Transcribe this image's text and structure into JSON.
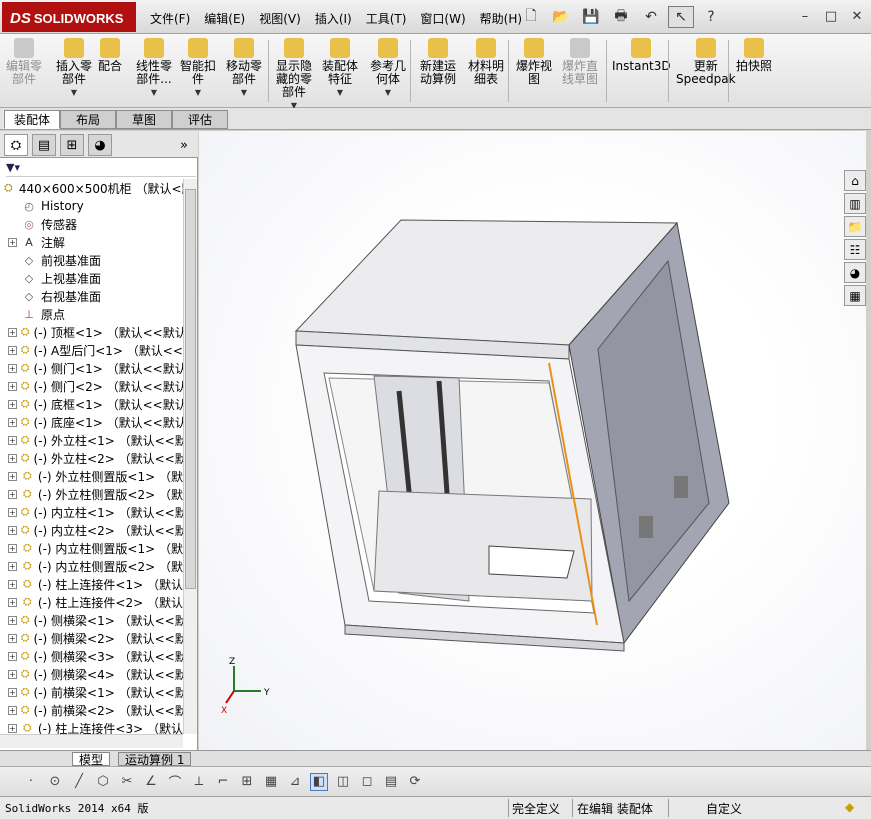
{
  "app": {
    "logo": "SOLIDWORKS",
    "logo_mark": "DS"
  },
  "menu": [
    "文件(F)",
    "编辑(E)",
    "视图(V)",
    "插入(I)",
    "工具(T)",
    "窗口(W)",
    "帮助(H)"
  ],
  "ribbon": [
    {
      "label": "编辑零\n部件",
      "disabled": true,
      "icon": "edit-component-icon"
    },
    {
      "label": "插入零\n部件",
      "icon": "insert-component-icon"
    },
    {
      "label": "配合",
      "icon": "mate-icon"
    },
    {
      "label": "线性零\n部件...",
      "icon": "linear-pattern-icon"
    },
    {
      "label": "智能扣\n件",
      "icon": "smart-fastener-icon"
    },
    {
      "label": "移动零\n部件",
      "icon": "move-component-icon"
    },
    {
      "label": "显示隐\n藏的零\n部件",
      "icon": "show-hidden-icon"
    },
    {
      "label": "装配体\n特征",
      "icon": "assembly-feature-icon"
    },
    {
      "label": "参考几\n何体",
      "icon": "reference-geometry-icon"
    },
    {
      "label": "新建运\n动算例",
      "icon": "motion-study-icon"
    },
    {
      "label": "材料明\n细表",
      "icon": "bom-icon"
    },
    {
      "label": "爆炸视\n图",
      "icon": "explode-view-icon"
    },
    {
      "label": "爆炸直\n线草图",
      "disabled": true,
      "icon": "explode-line-icon"
    },
    {
      "label": "Instant3D",
      "icon": "instant3d-icon"
    },
    {
      "label": "更新\nSpeedpak",
      "icon": "speedpak-icon"
    },
    {
      "label": "拍快照",
      "icon": "snapshot-icon"
    }
  ],
  "command_tabs": [
    "装配体",
    "布局",
    "草图",
    "评估"
  ],
  "tree": {
    "root": "440×600×500机柜 （默认<默",
    "fixed": [
      "History",
      "传感器",
      "注解",
      "前视基准面",
      "上视基准面",
      "右视基准面",
      "原点"
    ],
    "parts": [
      "(-) 顶框<1> （默认<<默认",
      "(-) A型后门<1> （默认<<默",
      "(-) 侧门<1> （默认<<默认",
      "(-) 侧门<2> （默认<<默认",
      "(-) 底框<1> （默认<<默认",
      "(-) 底座<1> （默认<<默认",
      "(-) 外立柱<1> （默认<<默",
      "(-) 外立柱<2> （默认<<默",
      "(-) 外立柱侧置版<1> （默",
      "(-) 外立柱侧置版<2> （默",
      "(-) 内立柱<1> （默认<<默",
      "(-) 内立柱<2> （默认<<默",
      "(-) 内立柱侧置版<1> （默",
      "(-) 内立柱侧置版<2> （默",
      "(-) 柱上连接件<1> （默认",
      "(-) 柱上连接件<2> （默认",
      "(-) 侧横梁<1> （默认<<默",
      "(-) 侧横梁<2> （默认<<默",
      "(-) 侧横梁<3> （默认<<默",
      "(-) 侧横梁<4> （默认<<默",
      "(-) 前横梁<1> （默认<<默",
      "(-) 前横梁<2> （默认<<默",
      "(-) 柱上连接件<3> （默认"
    ]
  },
  "triad": {
    "x": "X",
    "y": "Y",
    "z": "Z"
  },
  "bottom_tabs": [
    "模型",
    "运动算例 1"
  ],
  "status": {
    "version": "SolidWorks 2014 x64 版",
    "defined": "完全定义",
    "editing": "在编辑 装配体",
    "units": "自定义"
  },
  "colors": {
    "logo": "#b01010",
    "accent": "#e9901a",
    "panel": "#9fa2ad"
  }
}
